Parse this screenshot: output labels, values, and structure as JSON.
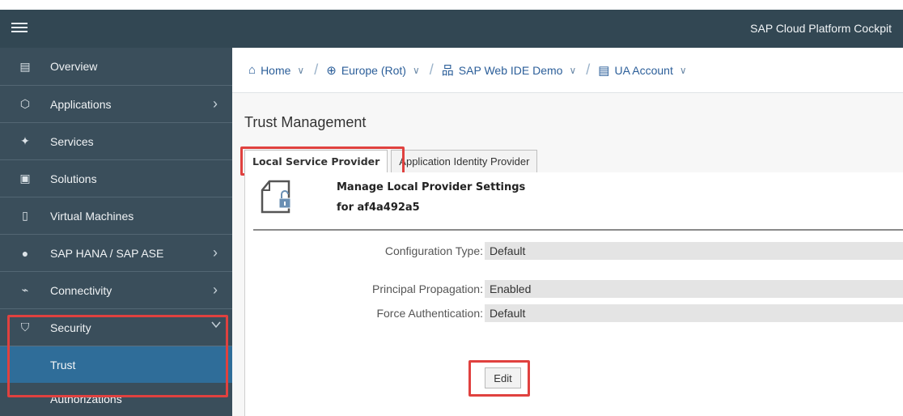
{
  "app": {
    "title": "SAP Cloud Platform Cockpit"
  },
  "sidebar": {
    "items": [
      {
        "label": "Overview",
        "icon": "overview-icon"
      },
      {
        "label": "Applications",
        "icon": "applications-icon"
      },
      {
        "label": "Services",
        "icon": "services-icon"
      },
      {
        "label": "Solutions",
        "icon": "solutions-icon"
      },
      {
        "label": "Virtual Machines",
        "icon": "virtual-machines-icon"
      },
      {
        "label": "SAP HANA / SAP ASE",
        "icon": "database-icon"
      },
      {
        "label": "Connectivity",
        "icon": "connectivity-icon"
      },
      {
        "label": "Security",
        "icon": "shield-icon"
      }
    ],
    "sub_items": [
      {
        "label": "Trust",
        "selected": true
      },
      {
        "label": "Authorizations",
        "selected": false
      }
    ]
  },
  "breadcrumb": [
    {
      "label": "Home",
      "icon": "home-icon"
    },
    {
      "label": "Europe (Rot)",
      "icon": "globe-icon"
    },
    {
      "label": "SAP Web IDE Demo",
      "icon": "hierarchy-icon"
    },
    {
      "label": "UA Account",
      "icon": "account-icon"
    }
  ],
  "page": {
    "title": "Trust Management"
  },
  "tabs": [
    {
      "label": "Local Service Provider",
      "active": true
    },
    {
      "label": "Application Identity Provider",
      "active": false
    }
  ],
  "panel": {
    "title": "Manage Local Provider Settings",
    "subtitle": "for af4a492a5",
    "fields": [
      {
        "label": "Configuration Type:",
        "value": "Default"
      },
      {
        "label": "Principal Propagation:",
        "value": "Enabled"
      },
      {
        "label": "Force Authentication:",
        "value": "Default"
      }
    ],
    "edit_label": "Edit"
  },
  "colors": {
    "topbar": "#324753",
    "sidebar": "#3a4e5b",
    "selected": "#2f6d99",
    "highlight": "#e0413f",
    "link": "#2b5e99"
  }
}
